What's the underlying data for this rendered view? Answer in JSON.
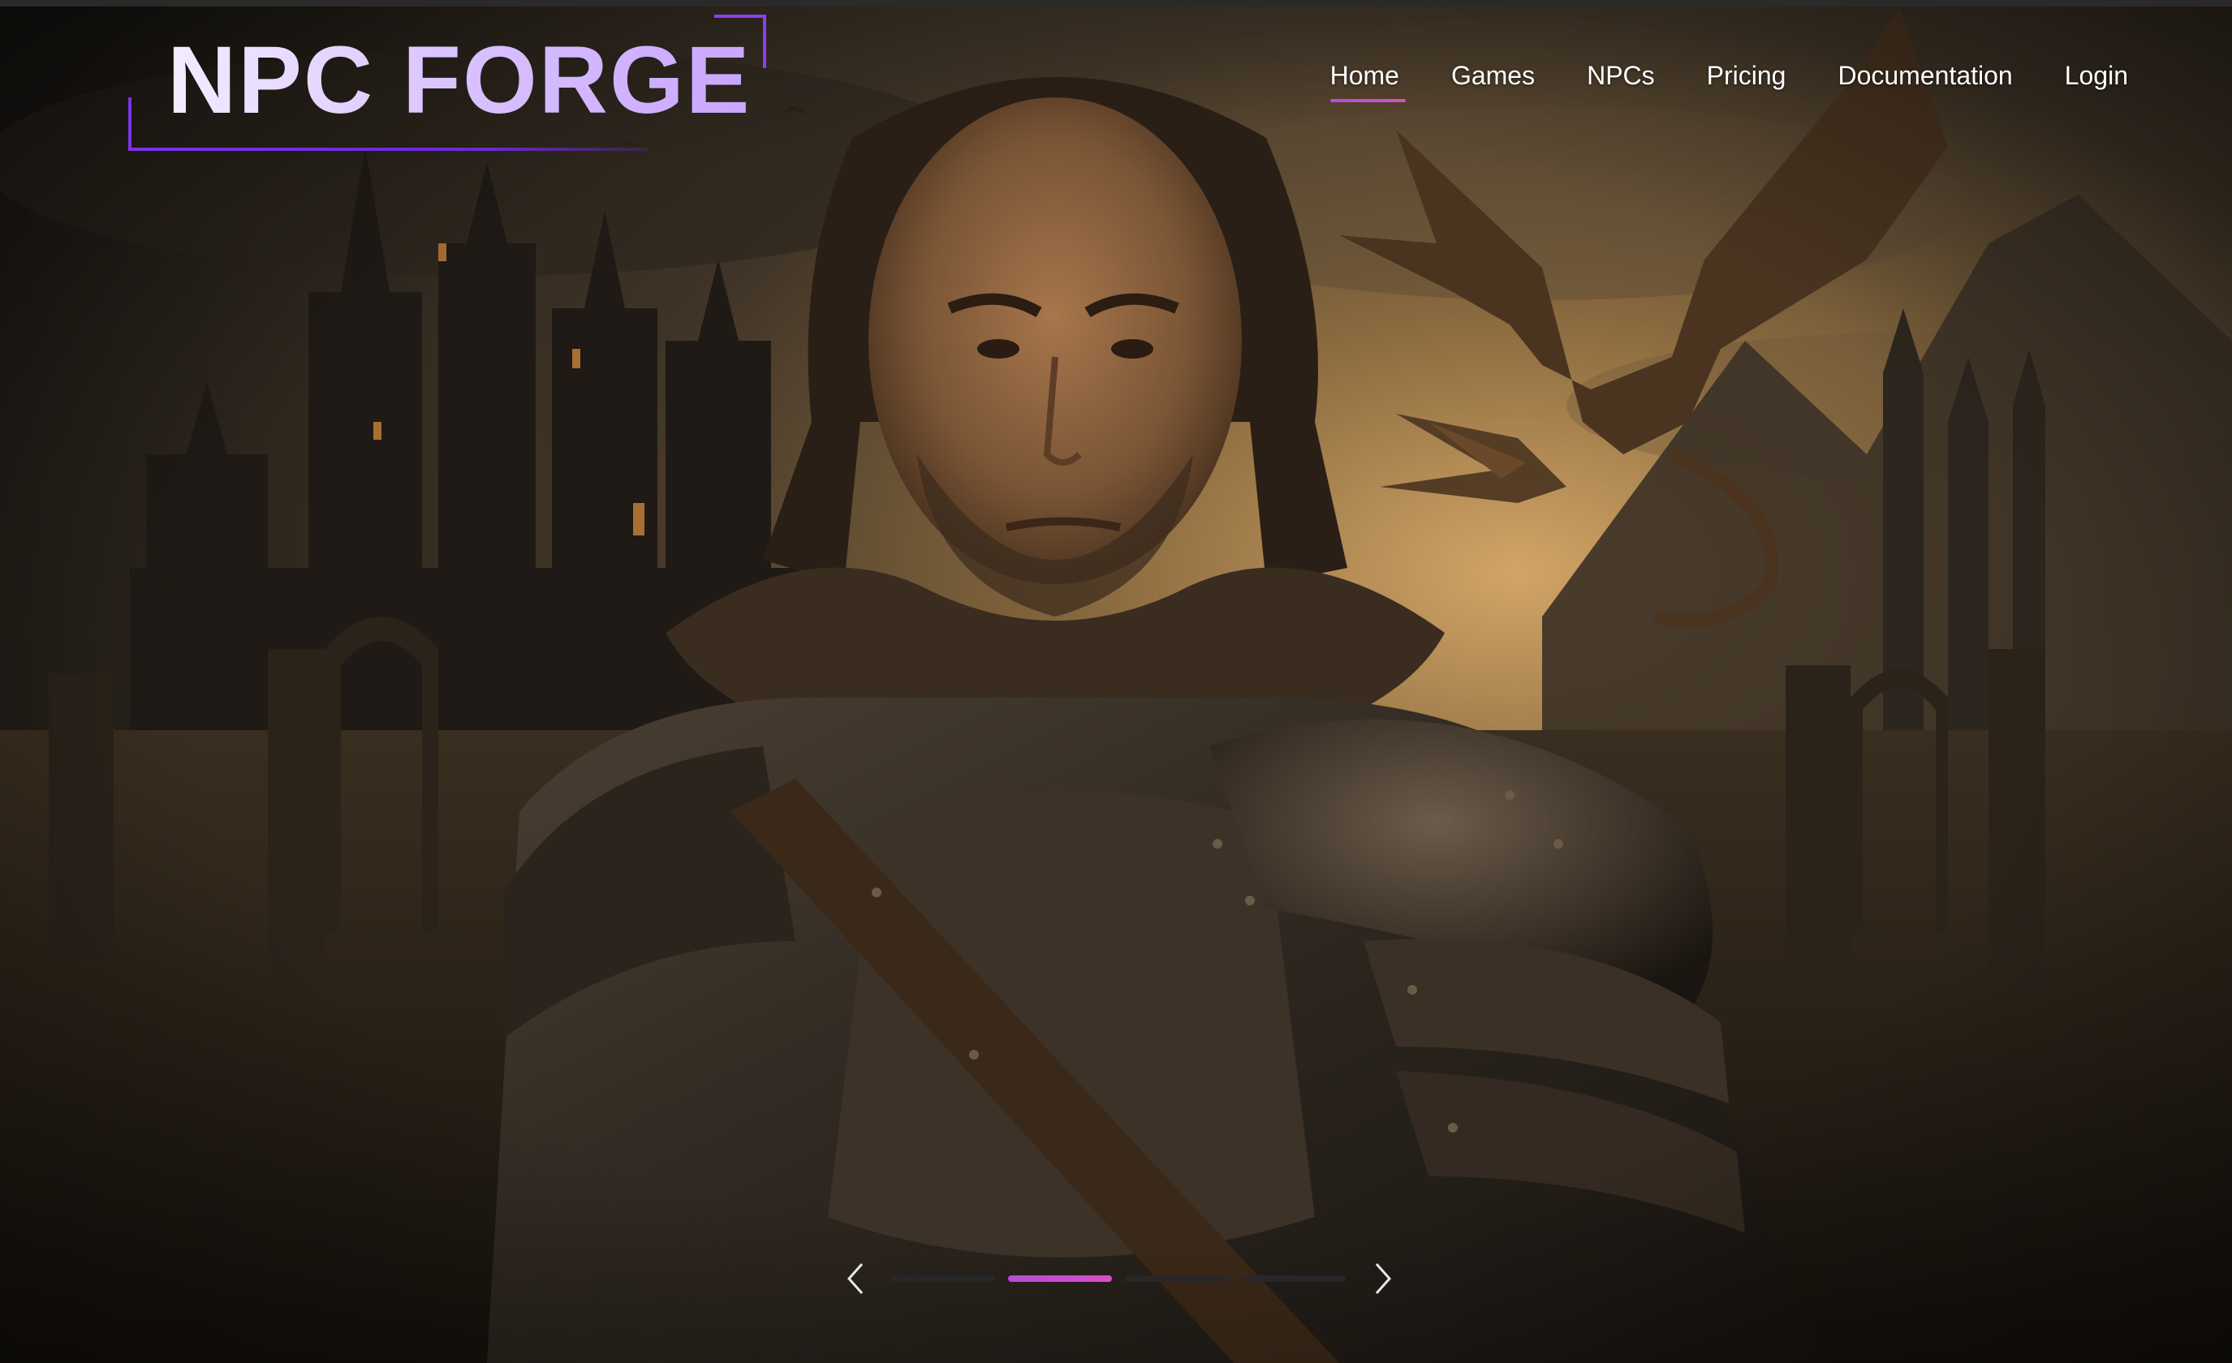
{
  "brand": {
    "logo_text": "NPC FORGE",
    "accent_color": "#8b3df0",
    "highlight_color": "#d94fc6"
  },
  "nav": {
    "items": [
      {
        "label": "Home",
        "active": true
      },
      {
        "label": "Games",
        "active": false
      },
      {
        "label": "NPCs",
        "active": false
      },
      {
        "label": "Pricing",
        "active": false
      },
      {
        "label": "Documentation",
        "active": false
      },
      {
        "label": "Login",
        "active": false
      }
    ]
  },
  "hero": {
    "image_subject": "armored-warrior-with-castle-and-dragons"
  },
  "carousel": {
    "slide_count": 4,
    "active_index": 1,
    "prev_icon": "chevron-left-icon",
    "next_icon": "chevron-right-icon"
  }
}
